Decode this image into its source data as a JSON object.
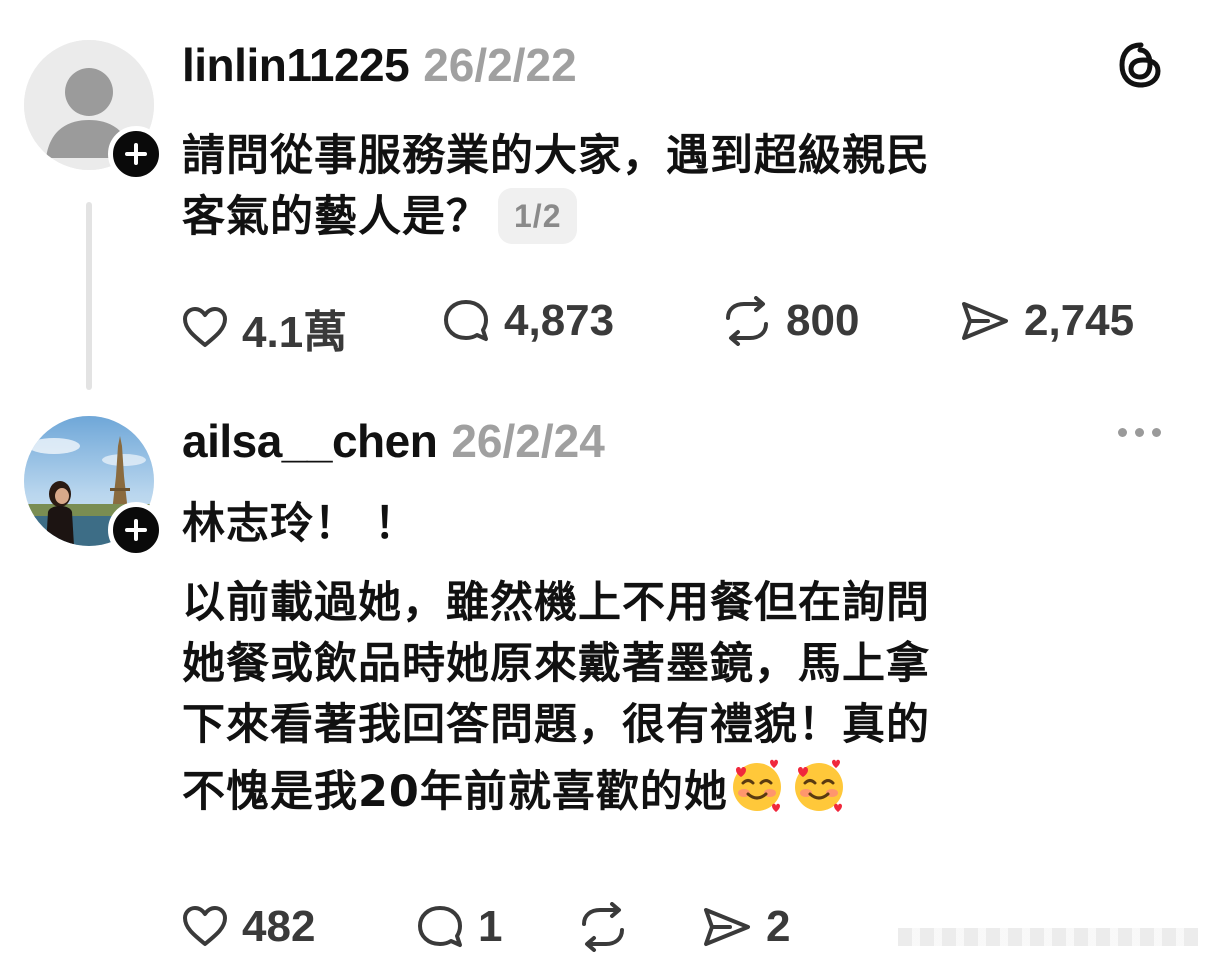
{
  "app": {
    "brand_icon": "threads-logo-icon"
  },
  "posts": [
    {
      "username": "linlin11225",
      "date": "26/2/22",
      "text_lines": [
        "請問從事服務業的大家，遇到超級親民",
        "客氣的藝人是？"
      ],
      "page_indicator": "1/2",
      "avatar_icon": "default-avatar-icon",
      "actions": {
        "likes": "4.1萬",
        "replies": "4,873",
        "reposts": "800",
        "shares": "2,745"
      }
    },
    {
      "username": "ailsa__chen",
      "date": "26/2/24",
      "text_lines": [
        "林志玲！ ！",
        "以前載過她，雖然機上不用餐但在詢問",
        "她餐或飲品時她原來戴著墨鏡，馬上拿",
        "下來看著我回答問題，很有禮貌！真的",
        "不愧是我20年前就喜歡的她"
      ],
      "emojis": [
        "smiling-face-with-hearts-emoji",
        "smiling-face-with-hearts-emoji"
      ],
      "avatar_icon": "eiffel-tower-photo-avatar",
      "actions": {
        "likes": "482",
        "replies": "1",
        "reposts": "",
        "shares": "2"
      }
    }
  ],
  "colors": {
    "text": "#111111",
    "muted": "#a0a0a0",
    "action": "#3a3a3a",
    "thread_line": "#e3e3e3"
  }
}
